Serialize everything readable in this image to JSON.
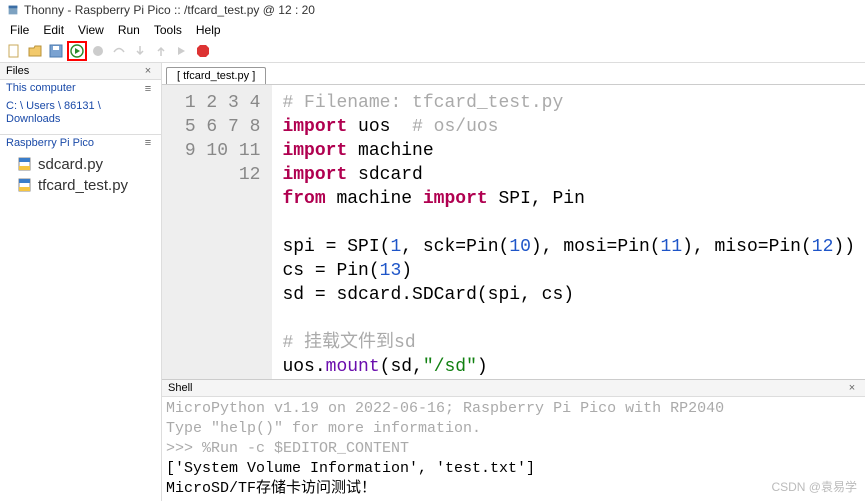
{
  "title": "Thonny  -  Raspberry Pi Pico :: /tfcard_test.py  @  12 : 20",
  "menu": {
    "file": "File",
    "edit": "Edit",
    "view": "View",
    "run": "Run",
    "tools": "Tools",
    "help": "Help"
  },
  "files": {
    "hdr": "Files",
    "computer_label": "This computer",
    "computer_path": "C: \\ Users \\ 86131 \\ Downloads",
    "device_label": "Raspberry Pi Pico",
    "items": [
      {
        "name": "sdcard.py"
      },
      {
        "name": "tfcard_test.py"
      }
    ]
  },
  "tab": "[ tfcard_test.py ]",
  "code": {
    "l1_a": "# Filename: tfcard_test.py",
    "l2_a": "import",
    "l2_b": " uos  ",
    "l2_c": "# os/uos",
    "l3_a": "import",
    "l3_b": " machine",
    "l4_a": "import",
    "l4_b": " sdcard",
    "l5_a": "from",
    "l5_b": " machine ",
    "l5_c": "import",
    "l5_d": " SPI, Pin",
    "l7_a": "spi = SPI(",
    "l7_b": "1",
    "l7_c": ", sck=Pin(",
    "l7_d": "10",
    "l7_e": "), mosi=Pin(",
    "l7_f": "11",
    "l7_g": "), miso=Pin(",
    "l7_h": "12",
    "l7_i": "))",
    "l8_a": "cs = Pin(",
    "l8_b": "13",
    "l8_c": ")",
    "l9_a": "sd = sdcard.SDCard(spi, cs)",
    "l11_a": "# 挂载文件到sd",
    "l12_a": "uos.",
    "l12_b": "mount",
    "l12_c": "(sd,",
    "l12_d": "\"/sd\"",
    "l12_e": ")"
  },
  "gutter": [
    "1",
    "2",
    "3",
    "4",
    "5",
    "6",
    "7",
    "8",
    "9",
    "10",
    "11",
    "12"
  ],
  "shell": {
    "hdr": "Shell",
    "line1": "MicroPython v1.19 on 2022-06-16; Raspberry Pi Pico with RP2040",
    "line2": "Type \"help()\" for more information.",
    "line3": ">>> %Run -c $EDITOR_CONTENT",
    "line4": " ['System Volume Information', 'test.txt']",
    "line5": " MicroSD/TF存储卡访问测试！"
  },
  "watermark": "CSDN @袁易学"
}
